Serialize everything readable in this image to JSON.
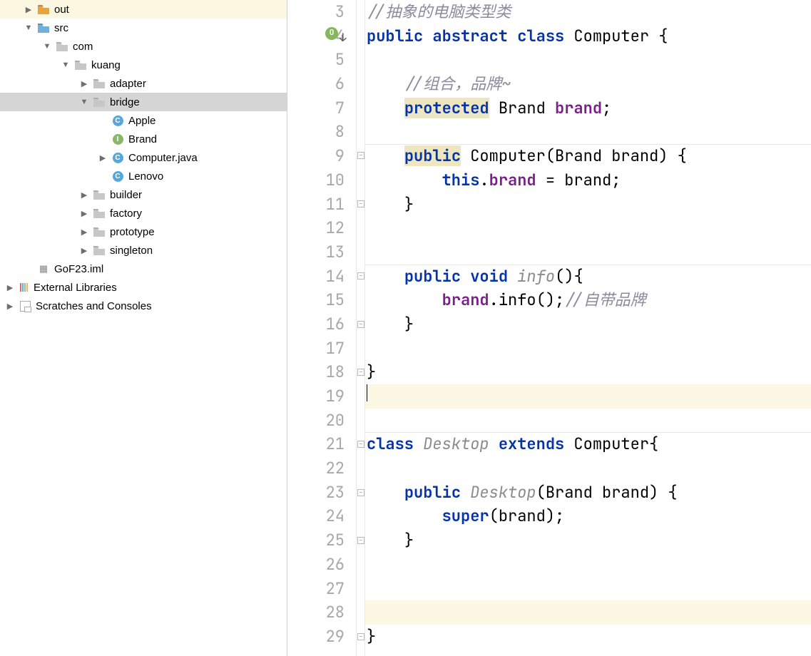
{
  "tree": {
    "out": "out",
    "src": "src",
    "com": "com",
    "kuang": "kuang",
    "adapter": "adapter",
    "bridge": "bridge",
    "apple": "Apple",
    "brand": "Brand",
    "computer": "Computer.java",
    "lenovo": "Lenovo",
    "builder": "builder",
    "factory": "factory",
    "prototype": "prototype",
    "singleton": "singleton",
    "iml": "GoF23.iml",
    "extlib": "External Libraries",
    "scratch": "Scratches and Consoles"
  },
  "code": {
    "l3": "//抽象的电脑类型类",
    "l4_public": "public",
    "l4_abstract": "abstract",
    "l4_class": "class",
    "l4_name": " Computer {",
    "l6": "//组合，品牌~",
    "l7_protected": "protected",
    "l7_rest": " Brand ",
    "l7_brand": "brand",
    "l7_semi": ";",
    "l9_public": "public",
    "l9_rest": " Computer(Brand brand) {",
    "l10_this": "this",
    "l10_dot": ".",
    "l10_brand": "brand",
    "l10_rest": " = brand;",
    "l11": "}",
    "l14_public": "public",
    "l14_void": "void",
    "l14_name": " info",
    "l14_rest": "(){",
    "l15_a": "brand",
    "l15_b": ".info();",
    "l15_c": "//自带品牌",
    "l16": "}",
    "l18": "}",
    "l21_class": "class",
    "l21_name": " Desktop ",
    "l21_extends": "extends",
    "l21_rest": " Computer{",
    "l23_public": "public",
    "l23_rest": " Desktop",
    "l23_paren": "(Brand brand) {",
    "l24_super": "super",
    "l24_rest": "(brand);",
    "l25": "}",
    "l29": "}"
  },
  "line_numbers": [
    "3",
    "4",
    "5",
    "6",
    "7",
    "8",
    "9",
    "10",
    "11",
    "12",
    "13",
    "14",
    "15",
    "16",
    "17",
    "18",
    "19",
    "20",
    "21",
    "22",
    "23",
    "24",
    "25",
    "26",
    "27",
    "28",
    "29"
  ]
}
